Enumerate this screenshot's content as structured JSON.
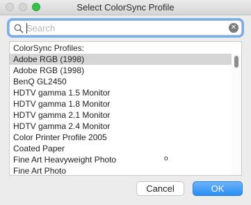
{
  "window": {
    "title": "Select ColorSync Profile",
    "colors": {
      "accent": "#2a8df4",
      "zoom_button": "#35c24a",
      "selection": "#d5d5d5"
    }
  },
  "search": {
    "placeholder": "Search",
    "value": "",
    "icons": {
      "search": "magnifier-icon",
      "clear": "clear-icon"
    }
  },
  "profiles": {
    "header": "ColorSync Profiles:",
    "selected_index": 0,
    "items": [
      "Adobe RGB (1998)",
      "Adobe RGB (1998)",
      "BenQ GL2450",
      "HDTV gamma 1.5 Monitor",
      "HDTV gamma 1.8 Monitor",
      "HDTV gamma 2.1 Monitor",
      "HDTV gamma 2.4 Monitor",
      "Color Printer Profile 2005",
      "Coated Paper",
      "Fine Art Heavyweight Photo",
      "Fine Art Photo"
    ]
  },
  "buttons": {
    "cancel": "Cancel",
    "ok": "OK"
  }
}
